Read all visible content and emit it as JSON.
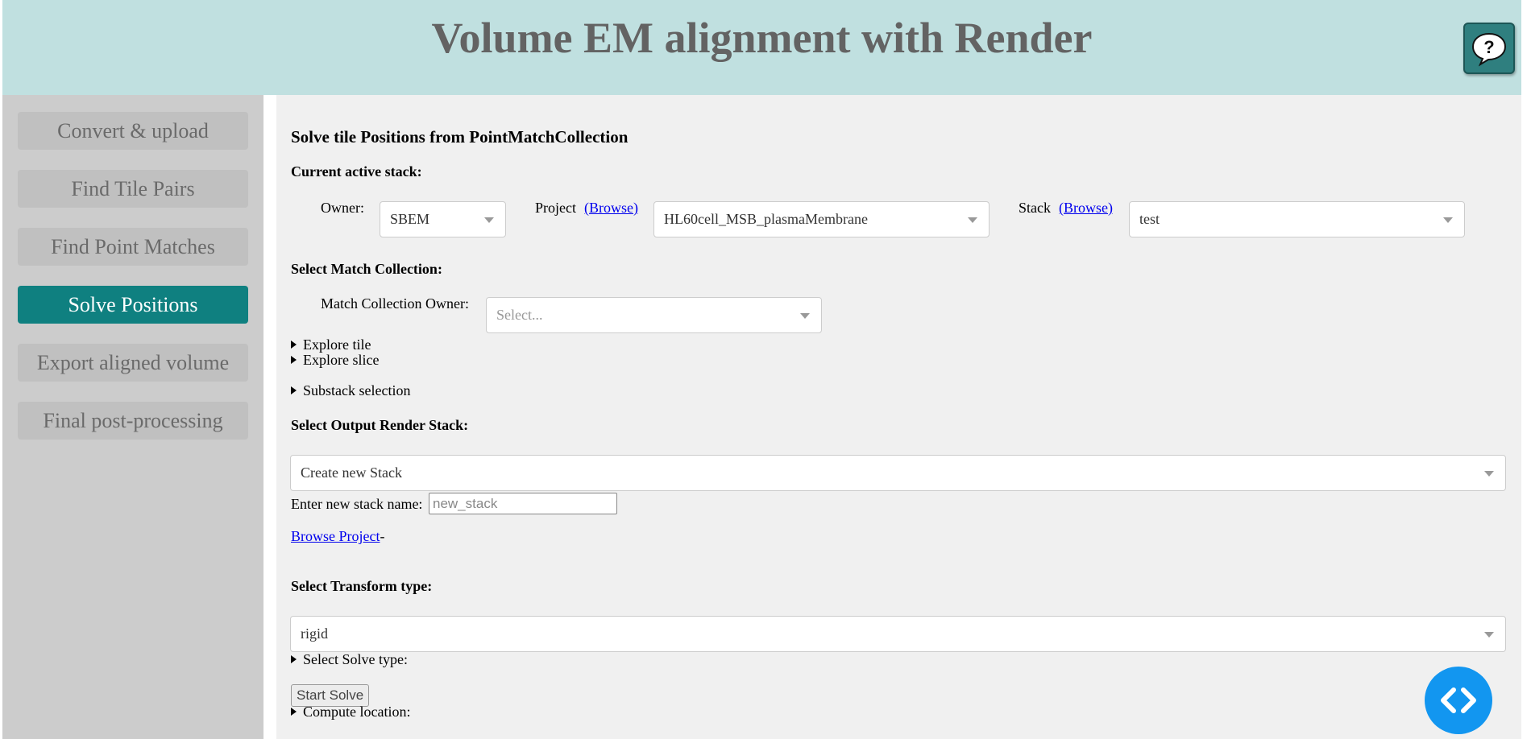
{
  "header": {
    "title": "Volume EM alignment with Render",
    "help_icon": "?"
  },
  "sidebar": {
    "items": [
      {
        "label": "Convert & upload"
      },
      {
        "label": "Find Tile Pairs"
      },
      {
        "label": "Find Point Matches"
      },
      {
        "label": "Solve Positions",
        "active": true
      },
      {
        "label": "Export aligned volume"
      },
      {
        "label": "Final post-processing"
      }
    ]
  },
  "main": {
    "title": "Solve tile Positions from PointMatchCollection",
    "current_stack": {
      "heading": "Current active stack:",
      "owner_label": "Owner:",
      "owner_value": "SBEM",
      "project_label": "Project",
      "project_browse": "(Browse)",
      "project_value": "HL60cell_MSB_plasmaMembrane",
      "stack_label": "Stack",
      "stack_browse": "(Browse)",
      "stack_value": "test"
    },
    "match_collection": {
      "heading": "Select Match Collection:",
      "owner_label": "Match Collection Owner:",
      "owner_placeholder": "Select..."
    },
    "toggles": {
      "explore_tile": "Explore tile",
      "explore_slice": "Explore slice",
      "substack": "Substack selection"
    },
    "output_stack": {
      "heading": "Select Output Render Stack:",
      "value": "Create new Stack",
      "new_name_label": "Enter new stack name:",
      "new_name_placeholder": "new_stack",
      "browse_project": "Browse Project",
      "browse_suffix": "-"
    },
    "transform": {
      "heading": "Select Transform type:",
      "value": "rigid"
    },
    "solve_type_toggle": "Select Solve type:",
    "start_button": "Start Solve",
    "compute_location_toggle": "Compute location:"
  },
  "colors": {
    "header_bg": "#c0e0e0",
    "sidebar_bg": "#cccccc",
    "active_nav": "#0f8080",
    "fab": "#1296f0"
  },
  "icons": {
    "help": "help-speech-bubble-icon",
    "fab": "code-icon"
  }
}
